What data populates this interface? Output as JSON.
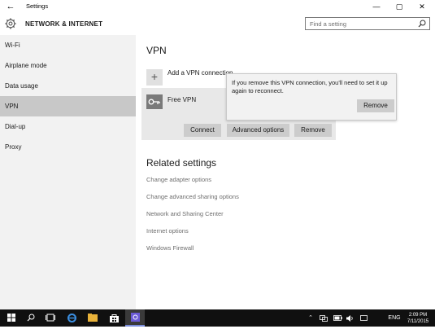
{
  "window": {
    "title": "Settings",
    "back_glyph": "←",
    "minimize_glyph": "—",
    "maximize_glyph": "▢",
    "close_glyph": "✕"
  },
  "header": {
    "section_title": "NETWORK & INTERNET",
    "search_placeholder": "Find a setting"
  },
  "sidebar": {
    "items": [
      {
        "label": "Wi-Fi",
        "selected": false
      },
      {
        "label": "Airplane mode",
        "selected": false
      },
      {
        "label": "Data usage",
        "selected": false
      },
      {
        "label": "VPN",
        "selected": true
      },
      {
        "label": "Dial-up",
        "selected": false
      },
      {
        "label": "Proxy",
        "selected": false
      }
    ]
  },
  "main": {
    "vpn_heading": "VPN",
    "add_vpn_label": "Add a VPN connection",
    "add_plus_glyph": "+",
    "vpn_connection_name": "Free VPN",
    "buttons": {
      "connect": "Connect",
      "advanced": "Advanced options",
      "remove": "Remove"
    },
    "popup": {
      "message": "If you remove this VPN connection, you'll need to set it up again to reconnect.",
      "remove_button": "Remove"
    },
    "related_heading": "Related settings",
    "related_links": [
      "Change adapter options",
      "Change advanced sharing options",
      "Network and Sharing Center",
      "Internet options",
      "Windows Firewall"
    ]
  },
  "taskbar": {
    "language": "ENG",
    "time": "2:09 PM",
    "date": "7/11/2015",
    "icons": [
      "windows-start-icon",
      "search-icon",
      "task-view-icon",
      "edge-icon",
      "file-explorer-icon",
      "store-icon",
      "settings-icon"
    ]
  },
  "colors": {
    "sidebar_bg": "#f2f2f2",
    "selected_bg": "#c8c8c8",
    "button_bg": "#cccccc",
    "taskbar_bg": "#101010",
    "link_gray": "#6e6e6e"
  }
}
